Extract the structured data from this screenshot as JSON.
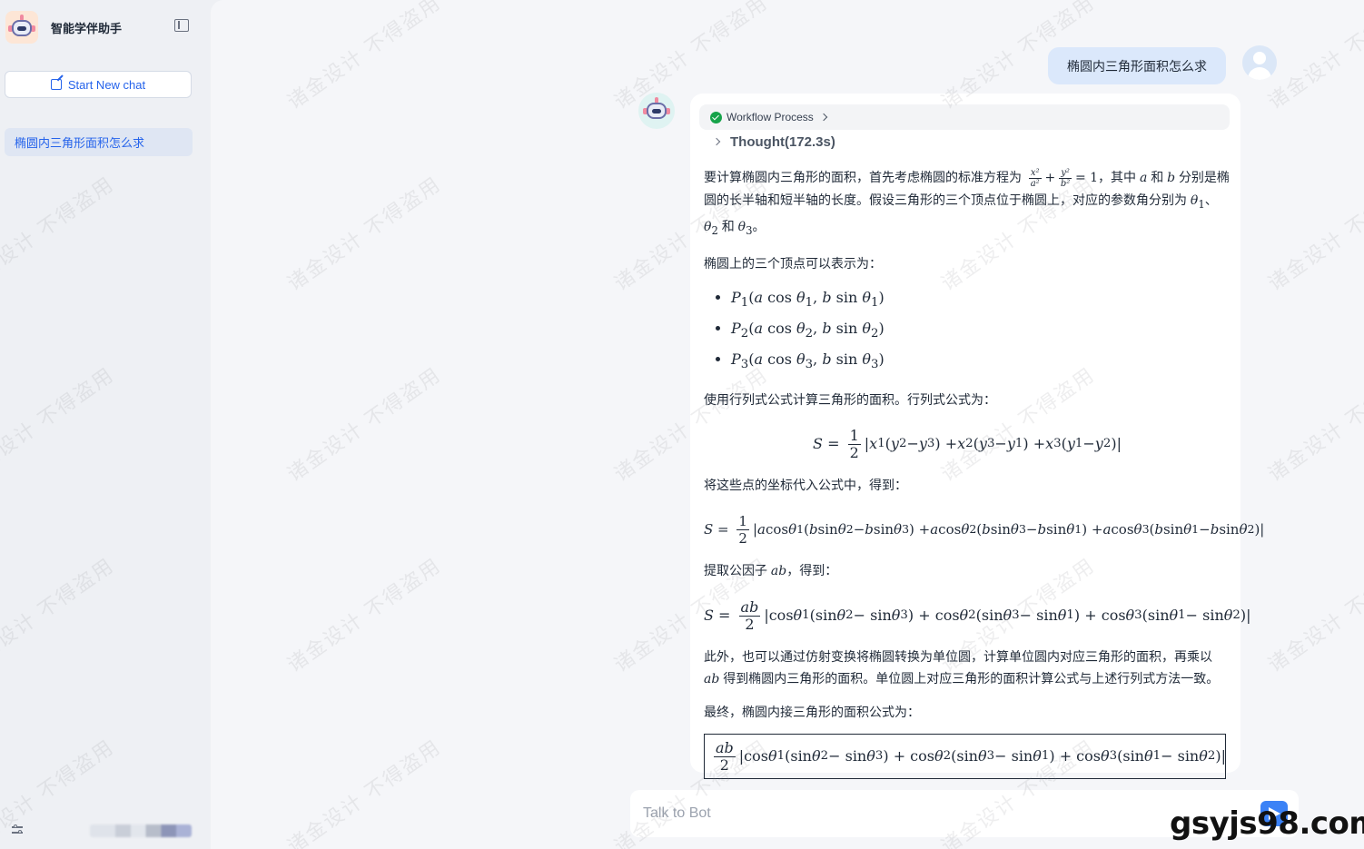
{
  "app": {
    "title": "智能学伴助手"
  },
  "sidebar": {
    "new_chat_label": "Start New chat",
    "conversations": [
      {
        "title": "椭圆内三角形面积怎么求"
      }
    ]
  },
  "chat": {
    "user_message": "椭圆内三角形面积怎么求",
    "workflow_label": "Workflow Process",
    "thought_label": "Thought(172.3s)",
    "answer": {
      "p1_a": "要计算椭圆内三角形的面积，首先考虑椭圆的标准方程为",
      "p1_b": "，其中",
      "p1_c": "和",
      "p1_d": "分别是椭圆的长半轴和短半轴的长度。假设三角形的三个顶点位于椭圆上，对应的参数角分别为",
      "p1_e": "和",
      "p2": "椭圆上的三个顶点可以表示为：",
      "p3": "使用行列式公式计算三角形的面积。行列式公式为：",
      "p4": "将这些点的坐标代入公式中，得到：",
      "p5_a": "提取公因子",
      "p5_b": "，得到：",
      "p6_a": "此外，也可以通过仿射变换将椭圆转换为单位圆，计算单位圆内对应三角形的面积，再乘以",
      "p6_b": "得到椭圆内三角形的面积。单位圆上对应三角形的面积计算公式与上述行列式方法一致。",
      "p7": "最终，椭圆内接三角形的面积公式为："
    }
  },
  "input": {
    "placeholder": "Talk to Bot"
  },
  "watermarks": {
    "text": "诸金设计 不得盗用",
    "site": "gsyjs98.com"
  },
  "colors": {
    "accent": "#2563eb",
    "success": "#16a34a",
    "user_bubble": "#dbe8fb"
  }
}
